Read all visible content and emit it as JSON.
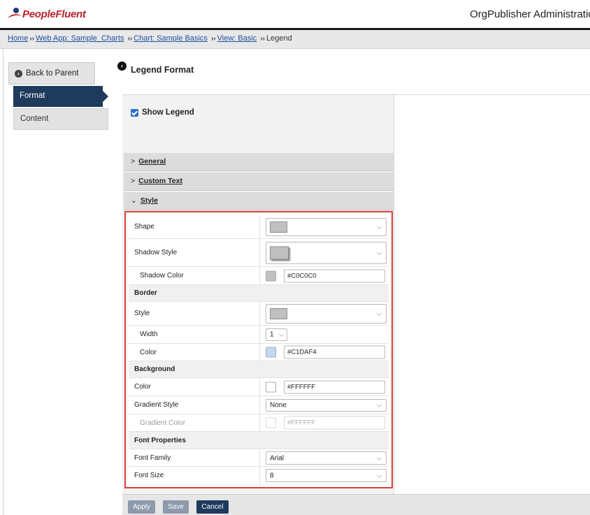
{
  "header": {
    "logo_text": "PeopleFluent",
    "app_title": "OrgPublisher Administration"
  },
  "breadcrumb": {
    "items": [
      "Home",
      "Web App: Sample_Charts",
      "Chart: Sample Basics",
      "View: Basic"
    ],
    "separator": "››",
    "current": "Legend"
  },
  "sidebar": {
    "back_label": "Back to Parent",
    "items": [
      {
        "label": "Format",
        "active": true
      },
      {
        "label": "Content",
        "active": false
      }
    ]
  },
  "panel": {
    "title": "Legend Format",
    "show_legend_label": "Show Legend",
    "show_legend_checked": true
  },
  "accordions": [
    {
      "label": "General",
      "expanded": false
    },
    {
      "label": "Custom Text",
      "expanded": false
    },
    {
      "label": "Style",
      "expanded": true
    }
  ],
  "style": {
    "shape_label": "Shape",
    "shadow_style_label": "Shadow Style",
    "shadow_color_label": "Shadow Color",
    "shadow_color_value": "#C0C0C0",
    "border_section": "Border",
    "border_style_label": "Style",
    "border_width_label": "Width",
    "border_width_value": "1",
    "border_color_label": "Color",
    "border_color_value": "#C1DAF4",
    "background_section": "Background",
    "bg_color_label": "Color",
    "bg_color_value": "#FFFFFF",
    "gradient_style_label": "Gradient Style",
    "gradient_style_value": "None",
    "gradient_color_label": "Gradient Color",
    "gradient_color_value": "#FFFFFF",
    "font_section": "Font Properties",
    "font_family_label": "Font Family",
    "font_family_value": "Arial",
    "font_size_label": "Font Size",
    "font_size_value": "8"
  },
  "colors": {
    "shadow_swatch": "#C0C0C0",
    "border_swatch": "#C1DAF4",
    "bg_swatch": "#FFFFFF",
    "gradient_swatch": "#FFFFFF",
    "highlight_border": "#D9403A",
    "nav_active": "#1E3A5C"
  },
  "buttons": {
    "apply": "Apply",
    "save": "Save",
    "cancel": "Cancel"
  }
}
